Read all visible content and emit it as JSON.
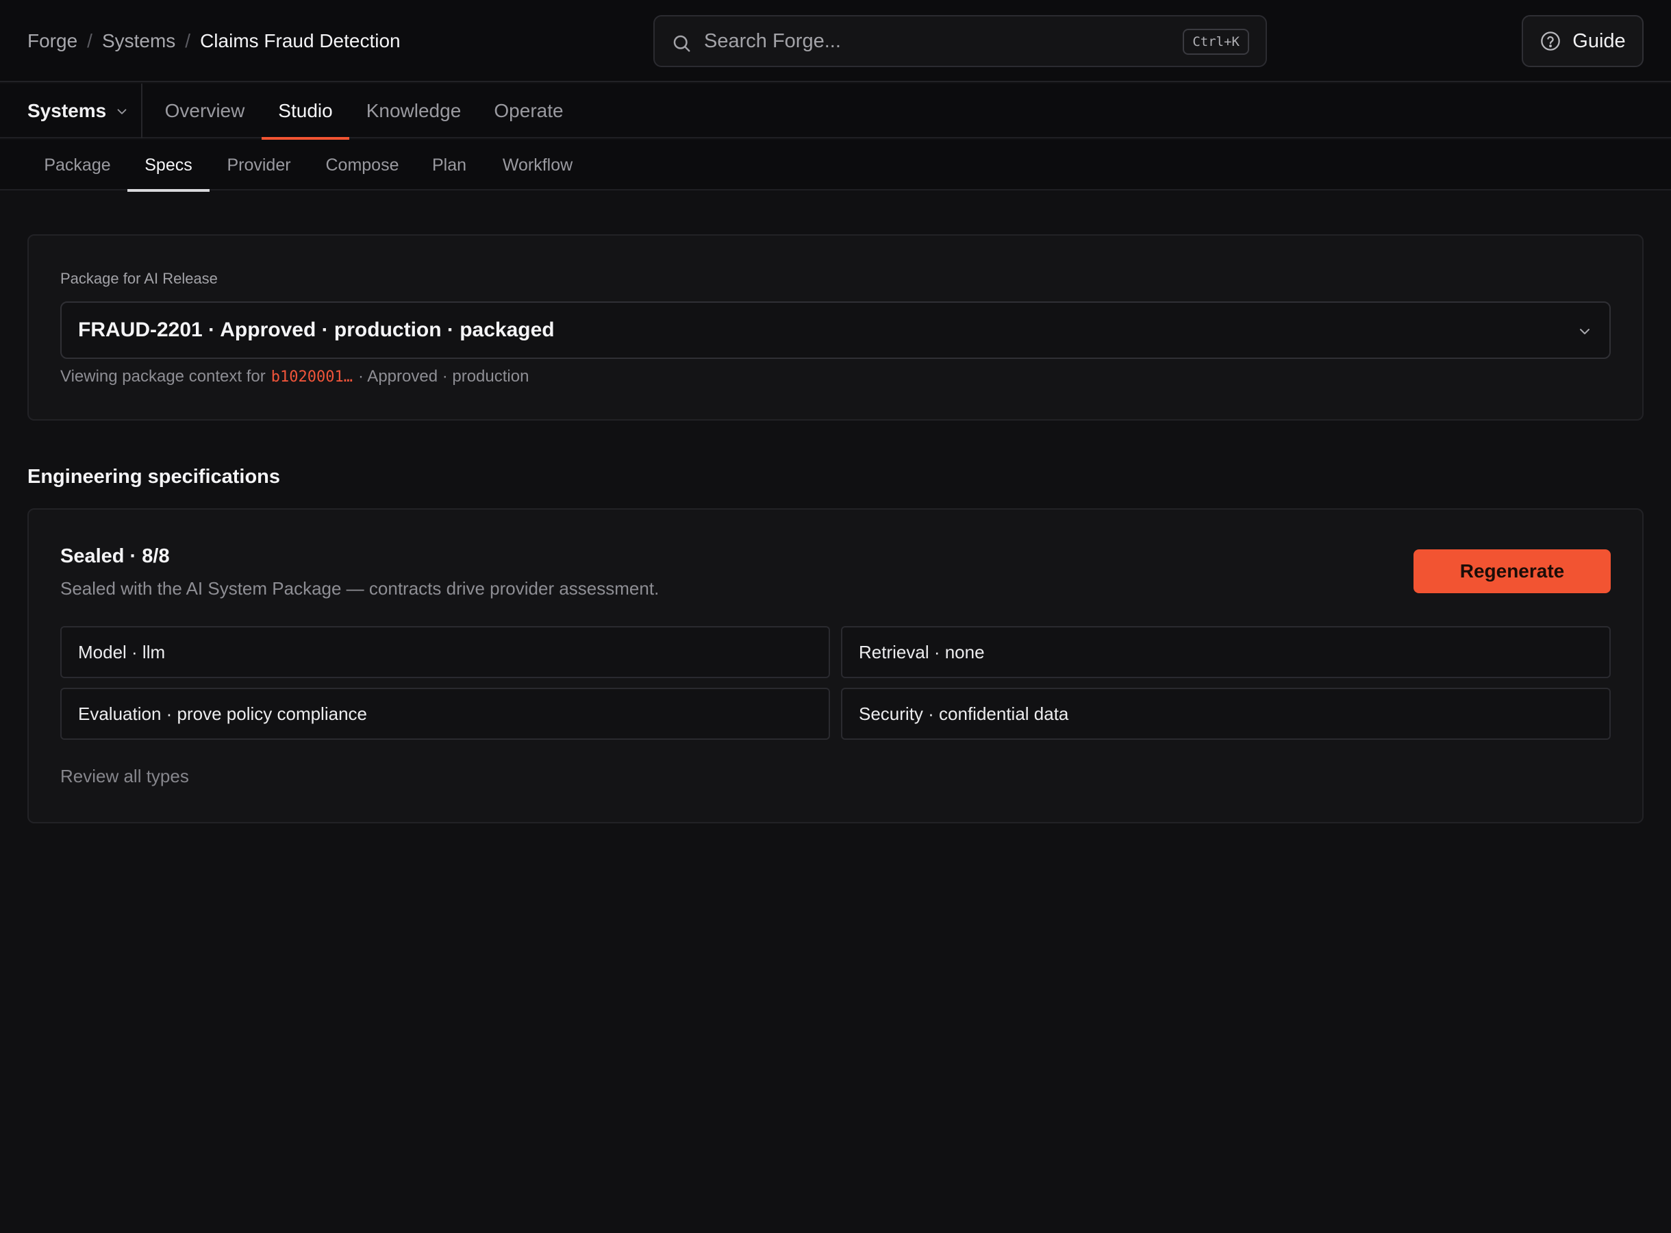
{
  "breadcrumb": {
    "items": [
      "Forge",
      "Systems",
      "Claims Fraud Detection"
    ],
    "separator": "/"
  },
  "search": {
    "placeholder": "Search Forge...",
    "shortcut": "Ctrl+K"
  },
  "header": {
    "guide_label": "Guide"
  },
  "primary_nav": {
    "switcher_label": "Systems",
    "tabs": [
      {
        "label": "Overview",
        "active": false
      },
      {
        "label": "Studio",
        "active": true
      },
      {
        "label": "Knowledge",
        "active": false
      },
      {
        "label": "Operate",
        "active": false
      }
    ]
  },
  "sub_nav": {
    "tabs": [
      {
        "label": "Package",
        "active": false
      },
      {
        "label": "Specs",
        "active": true
      },
      {
        "label": "Provider",
        "active": false
      },
      {
        "label": "Compose",
        "active": false
      },
      {
        "label": "Plan",
        "active": false
      },
      {
        "label": "Workflow",
        "active": false
      }
    ]
  },
  "package": {
    "label": "Package for AI Release",
    "selected": "FRAUD-2201 · Approved · production · packaged",
    "context_prefix": "Viewing package context for",
    "context_id": "b1020001…",
    "context_suffix": "· Approved · production"
  },
  "specs": {
    "section_title": "Engineering specifications",
    "status_title": "Sealed · 8/8",
    "description": "Sealed with the AI System Package — contracts drive provider assessment.",
    "regenerate_label": "Regenerate",
    "tiles": [
      "Model · llm",
      "Retrieval · none",
      "Evaluation · prove policy compliance",
      "Security · confidential data"
    ],
    "review_link": "Review all types"
  },
  "colors": {
    "accent": "#f25432",
    "background": "#101012",
    "card": "#141416",
    "text_muted": "#8e8e94"
  },
  "icons": [
    "search-icon",
    "help-circle-icon",
    "chevron-down-icon"
  ]
}
